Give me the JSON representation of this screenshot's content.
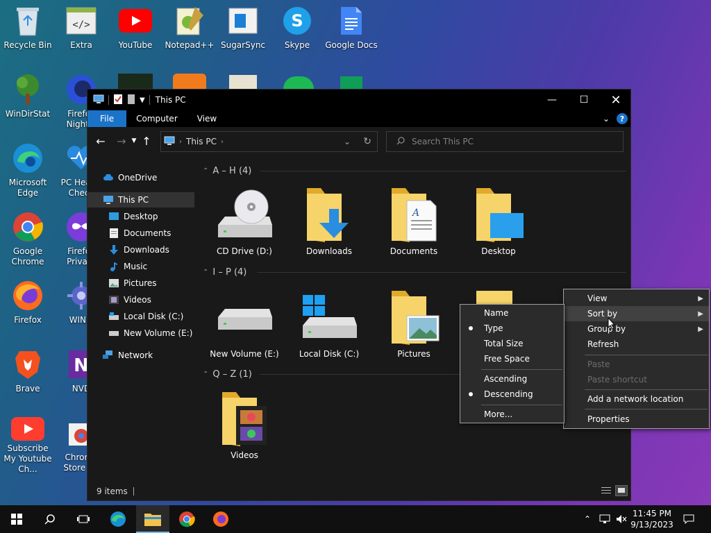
{
  "desktop": {
    "icons": [
      {
        "label": "Recycle Bin",
        "icon": "recycle-bin-icon"
      },
      {
        "label": "Extra",
        "icon": "code-file-icon"
      },
      {
        "label": "YouTube",
        "icon": "youtube-icon"
      },
      {
        "label": "Notepad++",
        "icon": "notepad-plus-plus-icon"
      },
      {
        "label": "SugarSync",
        "icon": "sugarsync-icon"
      },
      {
        "label": "Skype",
        "icon": "skype-icon"
      },
      {
        "label": "Google Docs",
        "icon": "google-docs-icon"
      },
      {
        "label": "WinDirStat",
        "icon": "windirstat-icon"
      },
      {
        "label": "Firefox Nightly",
        "icon": "firefox-nightly-icon"
      },
      {
        "label": "Microsoft Edge",
        "icon": "edge-icon"
      },
      {
        "label": "PC Health Check",
        "icon": "pc-health-check-icon"
      },
      {
        "label": "Google Chrome",
        "icon": "chrome-icon"
      },
      {
        "label": "Firefox Private",
        "icon": "firefox-private-icon"
      },
      {
        "label": "Firefox",
        "icon": "firefox-icon"
      },
      {
        "label": "WINM",
        "icon": "winm-icon"
      },
      {
        "label": "Brave",
        "icon": "brave-icon"
      },
      {
        "label": "NVD",
        "icon": "nvd-icon"
      },
      {
        "label": "Subscribe My Youtube Ch...",
        "icon": "youtube-subscribe-icon"
      },
      {
        "label": "Chrome Store - E",
        "icon": "chrome-store-icon"
      }
    ]
  },
  "explorer": {
    "title": "This PC",
    "tabs": {
      "file": "File",
      "computer": "Computer",
      "view": "View"
    },
    "address": "This PC",
    "search_placeholder": "Search This PC",
    "nav": {
      "onedrive": "OneDrive",
      "thispc": "This PC",
      "desktop": "Desktop",
      "documents": "Documents",
      "downloads": "Downloads",
      "music": "Music",
      "pictures": "Pictures",
      "videos": "Videos",
      "local_c": "Local Disk (C:)",
      "new_e": "New Volume (E:)",
      "network": "Network"
    },
    "groups": {
      "ah": "A – H (4)",
      "ip": "I – P (4)",
      "qz": "Q – Z (1)"
    },
    "items": {
      "cd": "CD Drive (D:)",
      "downloads": "Downloads",
      "documents": "Documents",
      "desktop": "Desktop",
      "new_e": "New Volume (E:)",
      "local_c": "Local Disk (C:)",
      "pictures": "Pictures",
      "videos": "Videos"
    },
    "status": "9 items"
  },
  "context_menu": {
    "view": "View",
    "sort_by": "Sort by",
    "group_by": "Group by",
    "refresh": "Refresh",
    "paste": "Paste",
    "paste_shortcut": "Paste shortcut",
    "add_network": "Add a network location",
    "properties": "Properties"
  },
  "sort_menu": {
    "name": "Name",
    "type": "Type",
    "total_size": "Total Size",
    "free_space": "Free Space",
    "ascending": "Ascending",
    "descending": "Descending",
    "more": "More..."
  },
  "taskbar": {
    "time": "11:45 PM",
    "date": "9/13/2023"
  },
  "colors": {
    "accent": "#1a73c9",
    "folder": "#f0c44c",
    "window_bg": "#191919"
  }
}
